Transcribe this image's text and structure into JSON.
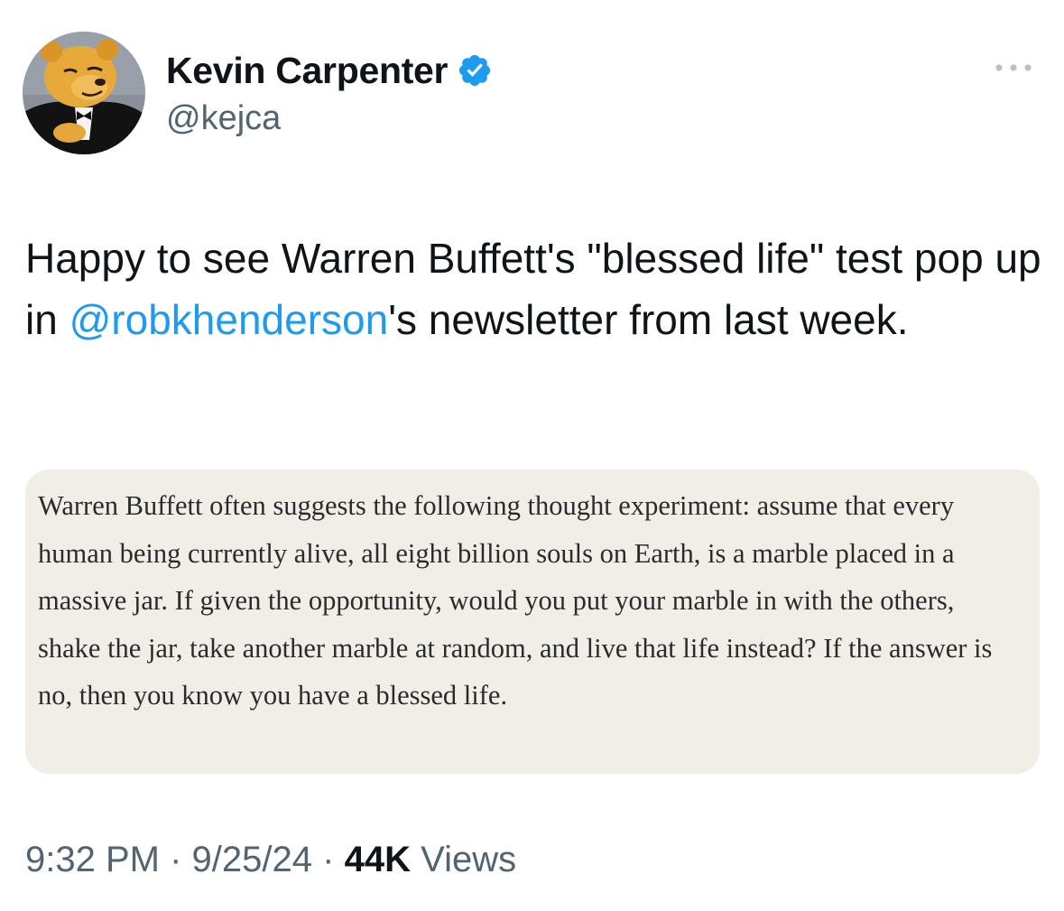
{
  "author": {
    "display_name": "Kevin Carpenter",
    "handle": "@kejca",
    "verified": true,
    "verified_color": "#1d9bf0",
    "avatar_icon": "pooh-bear-tuxedo-avatar"
  },
  "menu": {
    "icon": "more-options-icon"
  },
  "tweet": {
    "text_before": "Happy to see Warren Buffett's \"blessed life\" test pop up in ",
    "mention": "@robkhenderson",
    "text_after": "'s newsletter from last week."
  },
  "quote_image": {
    "text": "Warren Buffett often suggests the following thought experiment: assume that every human being currently alive, all eight billion souls on Earth, is a marble placed in a massive jar. If given the opportunity, would you put your marble in with the others, shake the jar, take another marble at random, and live that life instead? If the answer is no, then you know you have a blessed life.",
    "background": "#f1eee8"
  },
  "meta": {
    "time": "9:32 PM",
    "separator": "·",
    "date": "9/25/24",
    "views_count": "44K",
    "views_label": "Views"
  },
  "colors": {
    "text": "#0f1419",
    "secondary": "#536471",
    "link": "#1d9bf0"
  }
}
